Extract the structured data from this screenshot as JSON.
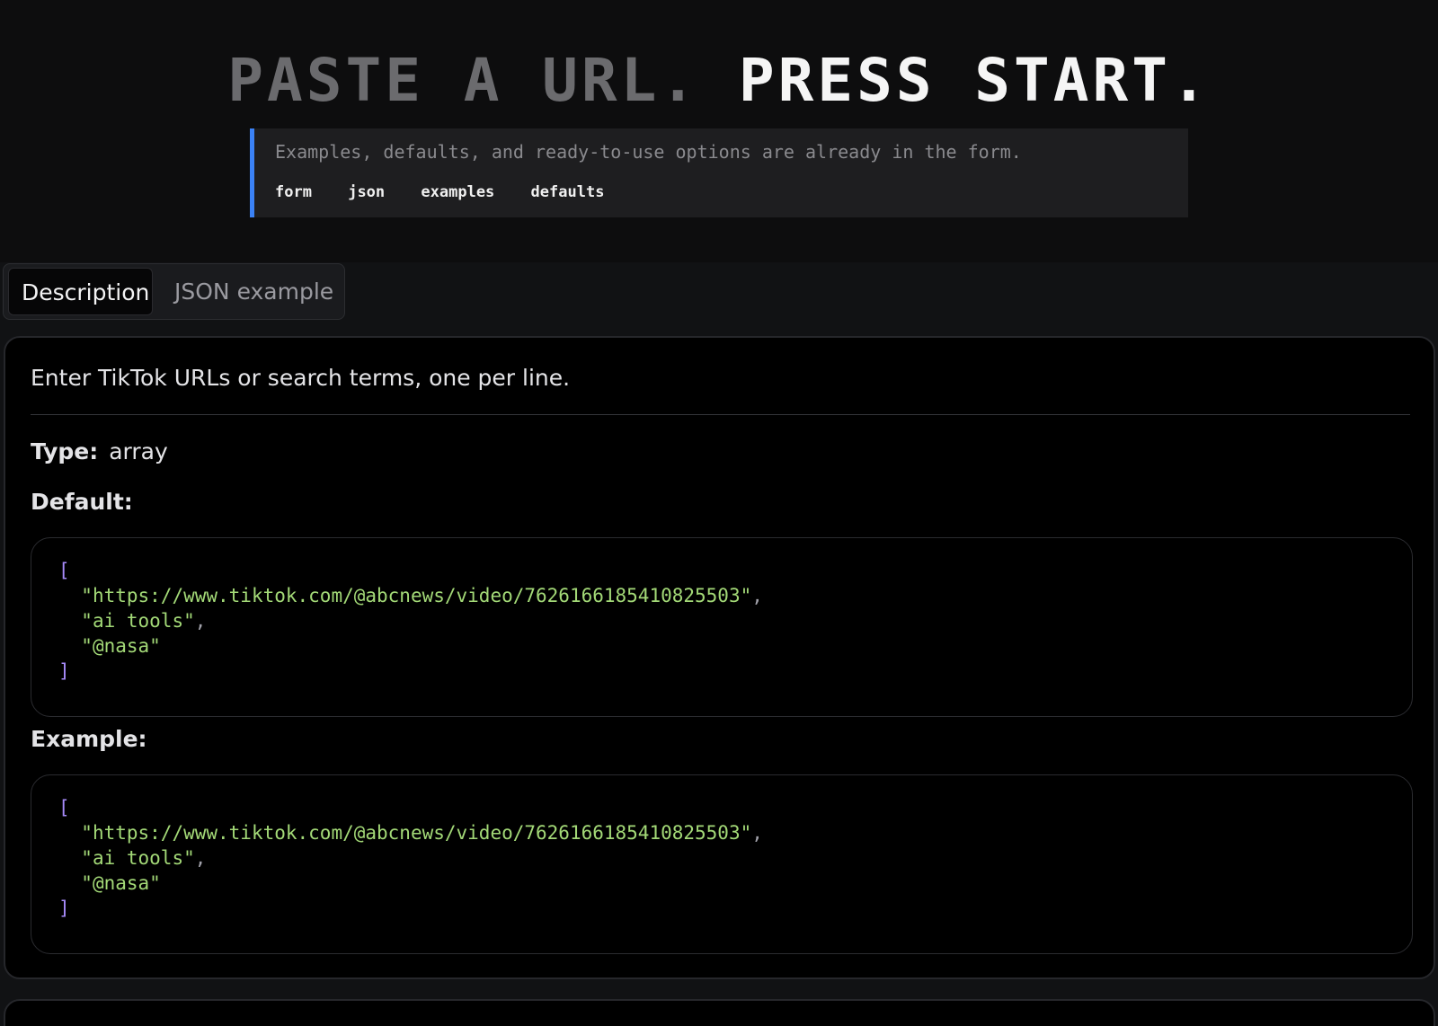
{
  "hero": {
    "title_dim": "PASTE A URL.",
    "title_bright": "PRESS START.",
    "hint": "Examples, defaults, and ready-to-use options are already in the form.",
    "tags": [
      "form",
      "json",
      "examples",
      "defaults"
    ]
  },
  "tabs": {
    "active": "Description",
    "inactive": "JSON example"
  },
  "field": {
    "description": "Enter TikTok URLs or search terms, one per line.",
    "type_label": "Type:",
    "type_value": "array",
    "default_label": "Default:",
    "example_label": "Example:",
    "default_items": [
      "\"https://www.tiktok.com/@abcnews/video/7626166185410825503\"",
      "\"ai tools\"",
      "\"@nasa\""
    ],
    "example_items": [
      "\"https://www.tiktok.com/@abcnews/video/7626166185410825503\"",
      "\"ai tools\"",
      "\"@nasa\""
    ],
    "open_bracket": "[",
    "close_bracket": "]",
    "comma": ","
  },
  "colors": {
    "accent": "#3b82f6",
    "string": "#a3d977",
    "bracket": "#a78bfa"
  }
}
